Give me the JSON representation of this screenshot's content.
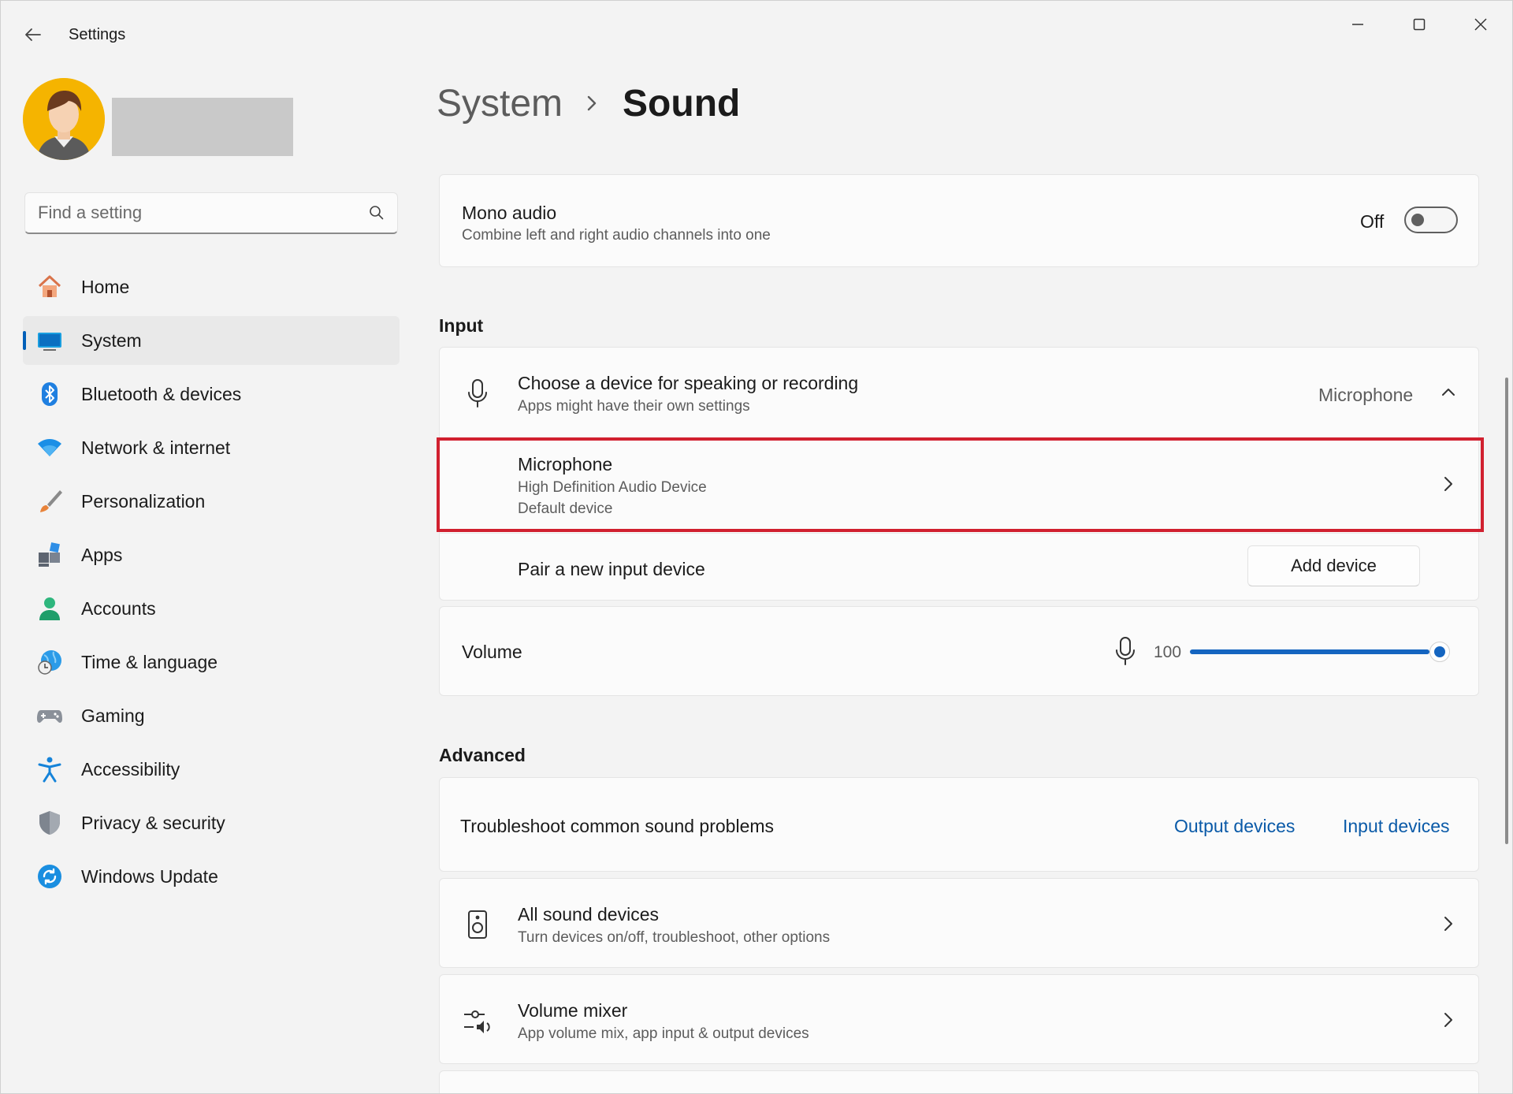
{
  "window": {
    "app_title": "Settings"
  },
  "sidebar": {
    "search_placeholder": "Find a setting",
    "items": [
      {
        "label": "Home",
        "icon": "home-icon",
        "active": false
      },
      {
        "label": "System",
        "icon": "system-icon",
        "active": true
      },
      {
        "label": "Bluetooth & devices",
        "icon": "bluetooth-icon",
        "active": false
      },
      {
        "label": "Network & internet",
        "icon": "wifi-icon",
        "active": false
      },
      {
        "label": "Personalization",
        "icon": "brush-icon",
        "active": false
      },
      {
        "label": "Apps",
        "icon": "apps-icon",
        "active": false
      },
      {
        "label": "Accounts",
        "icon": "person-icon",
        "active": false
      },
      {
        "label": "Time & language",
        "icon": "globe-clock-icon",
        "active": false
      },
      {
        "label": "Gaming",
        "icon": "gamepad-icon",
        "active": false
      },
      {
        "label": "Accessibility",
        "icon": "accessibility-icon",
        "active": false
      },
      {
        "label": "Privacy & security",
        "icon": "shield-icon",
        "active": false
      },
      {
        "label": "Windows Update",
        "icon": "update-icon",
        "active": false
      }
    ]
  },
  "breadcrumb": {
    "parent": "System",
    "current": "Sound"
  },
  "mono_audio": {
    "title": "Mono audio",
    "subtitle": "Combine left and right audio channels into one",
    "state_label": "Off"
  },
  "input": {
    "section_title": "Input",
    "choose_device": {
      "title": "Choose a device for speaking or recording",
      "subtitle": "Apps might have their own settings",
      "selected": "Microphone"
    },
    "microphone": {
      "title": "Microphone",
      "line1": "High Definition Audio Device",
      "line2": "Default device"
    },
    "pair": {
      "title": "Pair a new input device",
      "button": "Add device"
    },
    "volume": {
      "title": "Volume",
      "value": "100",
      "percent": 100
    }
  },
  "advanced": {
    "section_title": "Advanced",
    "troubleshoot": {
      "title": "Troubleshoot common sound problems",
      "link_output": "Output devices",
      "link_input": "Input devices"
    },
    "all_devices": {
      "title": "All sound devices",
      "subtitle": "Turn devices on/off, troubleshoot, other options"
    },
    "mixer": {
      "title": "Volume mixer",
      "subtitle": "App volume mix, app input & output devices"
    }
  },
  "colors": {
    "accent": "#005fb8",
    "slider": "#1565c0",
    "highlight": "#d1202f",
    "link": "#0a5aa8"
  }
}
